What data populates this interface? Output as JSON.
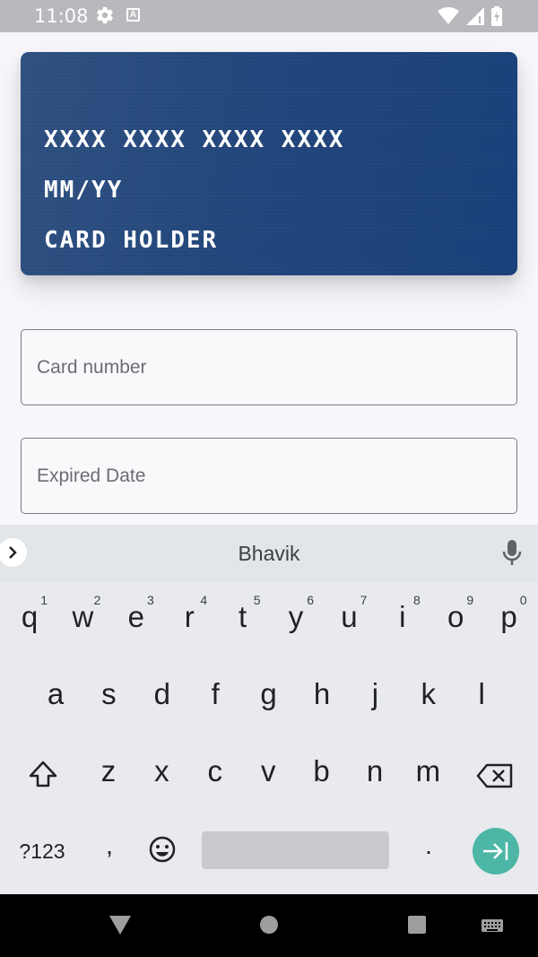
{
  "status_bar": {
    "time": "11:08",
    "icons": [
      "gear-icon",
      "a-icon",
      "wifi-icon",
      "signal-icon",
      "battery-icon"
    ]
  },
  "card": {
    "number": "XXXX XXXX XXXX XXXX",
    "expiry": "MM/YY",
    "holder": "CARD HOLDER"
  },
  "form": {
    "card_number_placeholder": "Card number",
    "expiry_placeholder": "Expired Date"
  },
  "keyboard": {
    "suggestion": "Bhavik",
    "row1": [
      "q",
      "w",
      "e",
      "r",
      "t",
      "y",
      "u",
      "i",
      "o",
      "p"
    ],
    "row1_hints": [
      "1",
      "2",
      "3",
      "4",
      "5",
      "6",
      "7",
      "8",
      "9",
      "0"
    ],
    "row2": [
      "a",
      "s",
      "d",
      "f",
      "g",
      "h",
      "j",
      "k",
      "l"
    ],
    "row3": [
      "z",
      "x",
      "c",
      "v",
      "b",
      "n",
      "m"
    ],
    "symbols_label": "?123",
    "comma": ",",
    "period": "."
  },
  "colors": {
    "card": "#22467b",
    "enter": "#4db6a6",
    "status_bar": "#b9b8bd"
  }
}
